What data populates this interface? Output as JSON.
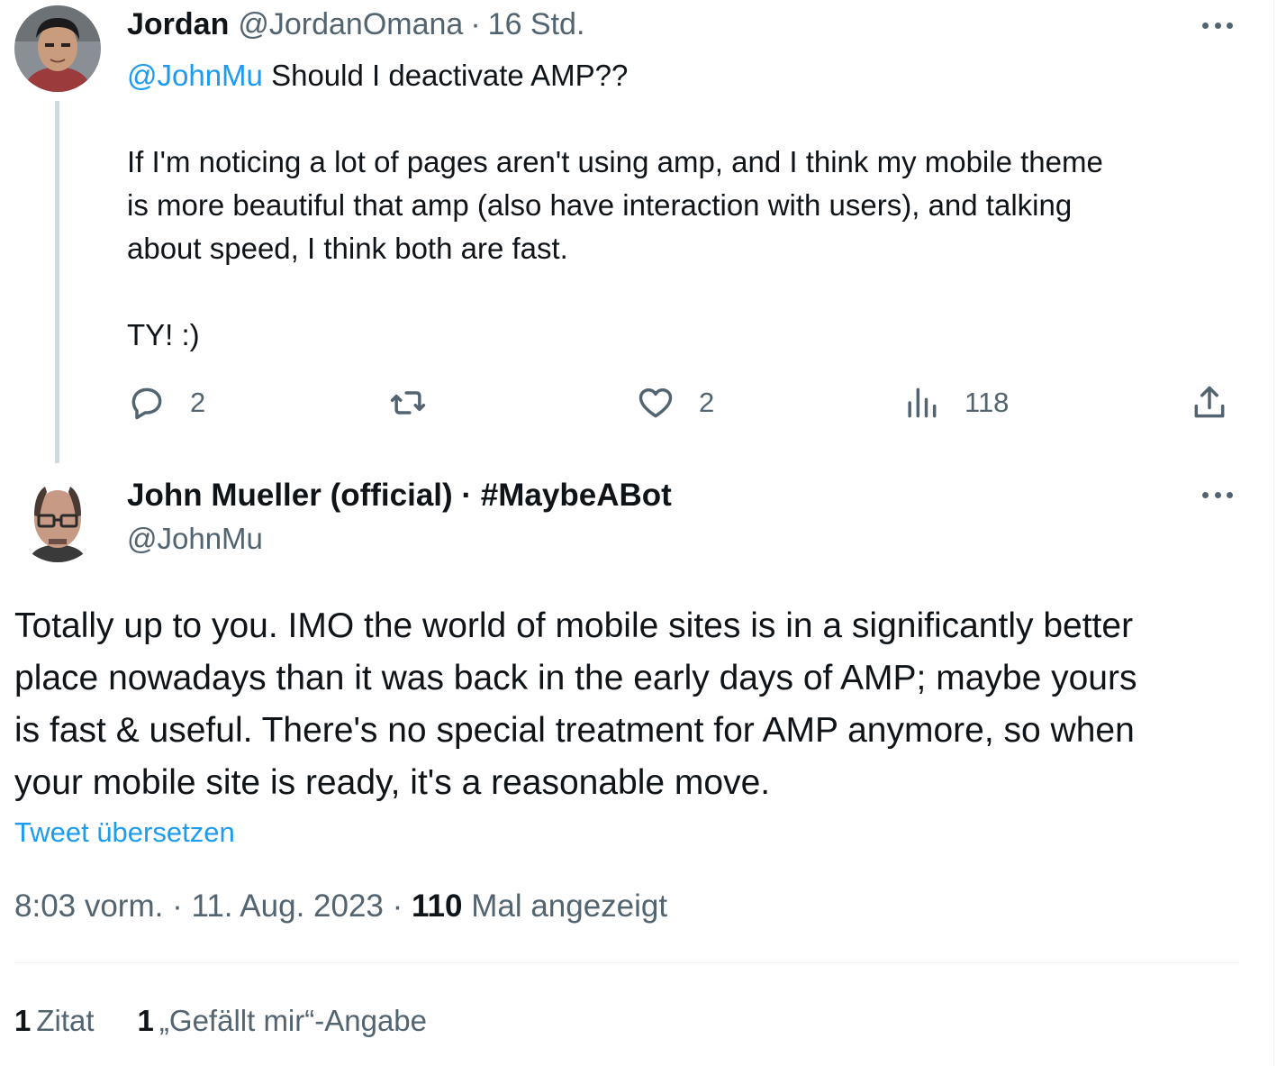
{
  "parent_tweet": {
    "author_name": "Jordan",
    "author_handle": "@JordanOmana",
    "separator": "·",
    "time_ago": "16 Std.",
    "mention": "@JohnMu",
    "line1_rest": " Should I deactivate AMP??",
    "paragraph2": [
      "If I'm noticing a lot of pages aren't using amp, and I think my mobile theme",
      "is more beautiful that amp (also have interaction with users), and talking",
      "about speed, I think both are fast."
    ],
    "paragraph3": "TY! :)",
    "actions": {
      "replies": "2",
      "retweets": "",
      "likes": "2",
      "views": "118"
    },
    "icons": [
      "reply-icon",
      "retweet-icon",
      "like-icon",
      "views-icon",
      "share-icon",
      "more-icon"
    ]
  },
  "main_tweet": {
    "author_name": "John Mueller (official) · #MaybeABot",
    "author_handle": "@JohnMu",
    "body_lines": [
      "Totally up to you. IMO the world of mobile sites is in a significantly better",
      "place nowadays than it was back in the early days of AMP; maybe yours",
      "is fast & useful. There's no special treatment for AMP anymore, so when",
      "your mobile site is ready, it's a reasonable move."
    ],
    "translate_label": "Tweet übersetzen",
    "timestamp": "8:03 vorm. · 11. Aug. 2023 · ",
    "view_count": "110",
    "view_label": " Mal angezeigt",
    "quotes_count": "1",
    "quotes_label": "Zitat",
    "likes_count": "1",
    "likes_label": "„Gefällt mir“-Angabe"
  },
  "colors": {
    "text": "#0f1419",
    "secondary": "#536471",
    "accent": "#1d9bf0",
    "thread_line": "#cfd9de",
    "divider": "#eff3f4"
  }
}
